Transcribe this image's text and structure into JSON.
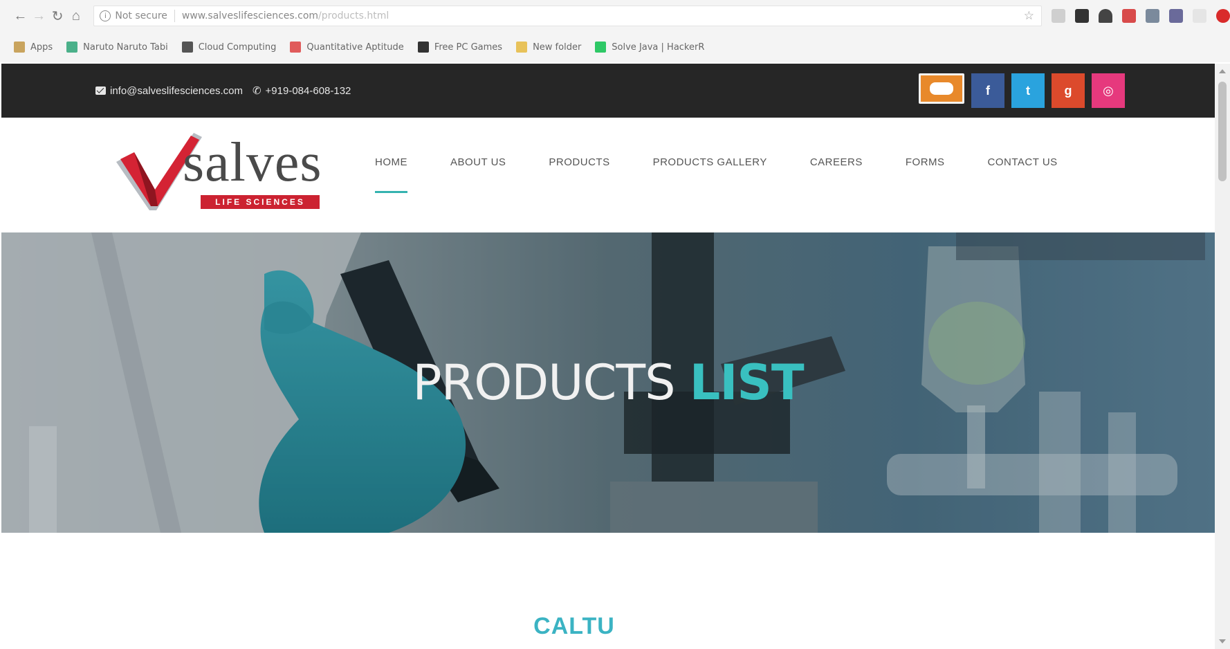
{
  "browser": {
    "security_label": "Not secure",
    "url_host": "www.salveslifesciences.com",
    "url_path": "/products.html",
    "bookmarks": [
      {
        "label": "Apps",
        "icon": "apps-grid-icon",
        "color": "#c9a45e"
      },
      {
        "label": "Naruto Naruto Tabi",
        "icon": "heart-icon",
        "color": "#4bb08a"
      },
      {
        "label": "Cloud Computing",
        "icon": "book-icon",
        "color": "#555555"
      },
      {
        "label": "Quantitative Aptitude",
        "icon": "bookmark-icon",
        "color": "#e05b5b"
      },
      {
        "label": "Free PC Games",
        "icon": "gamepad-icon",
        "color": "#333333"
      },
      {
        "label": "New folder",
        "icon": "folder-icon",
        "color": "#e8c25a"
      },
      {
        "label": "Solve Java | HackerR",
        "icon": "hackerrank-icon",
        "color": "#2ec866"
      }
    ]
  },
  "topbar": {
    "email": "info@salveslifesciences.com",
    "phone": "+919-084-608-132",
    "socials": [
      {
        "name": "chat",
        "glyph": ""
      },
      {
        "name": "facebook",
        "glyph": "f"
      },
      {
        "name": "twitter",
        "glyph": "t"
      },
      {
        "name": "google-plus",
        "glyph": "g"
      },
      {
        "name": "instagram",
        "glyph": "◎"
      }
    ]
  },
  "logo": {
    "word": "salves",
    "tagline": "LIFE SCIENCES"
  },
  "nav": {
    "items": [
      "HOME",
      "ABOUT US",
      "PRODUCTS",
      "PRODUCTS GALLERY",
      "CAREERS",
      "FORMS",
      "CONTACT US"
    ],
    "active_index": 0
  },
  "hero": {
    "title_main": "PRODUCTS ",
    "title_accent": "LIST"
  },
  "content": {
    "heading": "CALTU"
  },
  "colors": {
    "accent": "#39c0c0",
    "brand_red": "#cc2231",
    "topbar_bg": "#262626",
    "facebook": "#3b5b99",
    "twitter": "#2aa3de",
    "google_plus": "#dc4a2c",
    "instagram": "#e6397d"
  }
}
